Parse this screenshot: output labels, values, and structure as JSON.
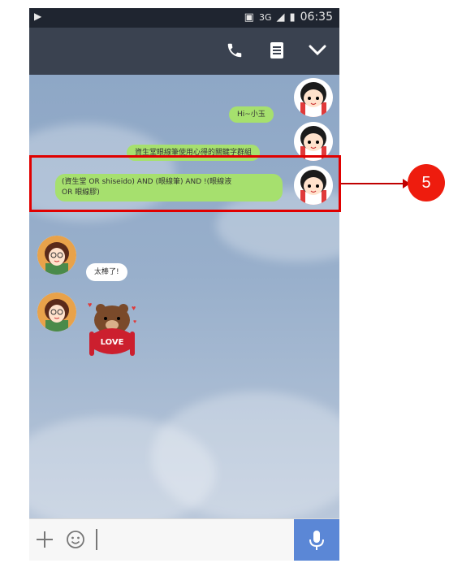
{
  "status_bar": {
    "time": "06:35",
    "network": "3G"
  },
  "header": {
    "icons": [
      "phone-icon",
      "notes-icon",
      "chevron-down-icon"
    ]
  },
  "messages": [
    {
      "side": "right",
      "type": "text",
      "text": "Hi~小玉"
    },
    {
      "side": "right",
      "type": "text",
      "text": "資生堂眼線筆使用心得的關鍵字群組"
    },
    {
      "side": "right",
      "type": "text",
      "lines": [
        "(資生堂 OR shiseido) AND (眼線筆) AND !(眼線液",
        "OR 眼線膠)"
      ]
    },
    {
      "side": "left",
      "type": "text",
      "text": "太棒了!"
    },
    {
      "side": "left",
      "type": "sticker",
      "text": "LOVE"
    }
  ],
  "annotation": {
    "step_number": "5",
    "highlight_color": "#e00000"
  },
  "colors": {
    "header": "#3a4250",
    "bubble_self": "#a6e06e",
    "bubble_other": "#ffffff",
    "mic": "#5b87d6"
  }
}
